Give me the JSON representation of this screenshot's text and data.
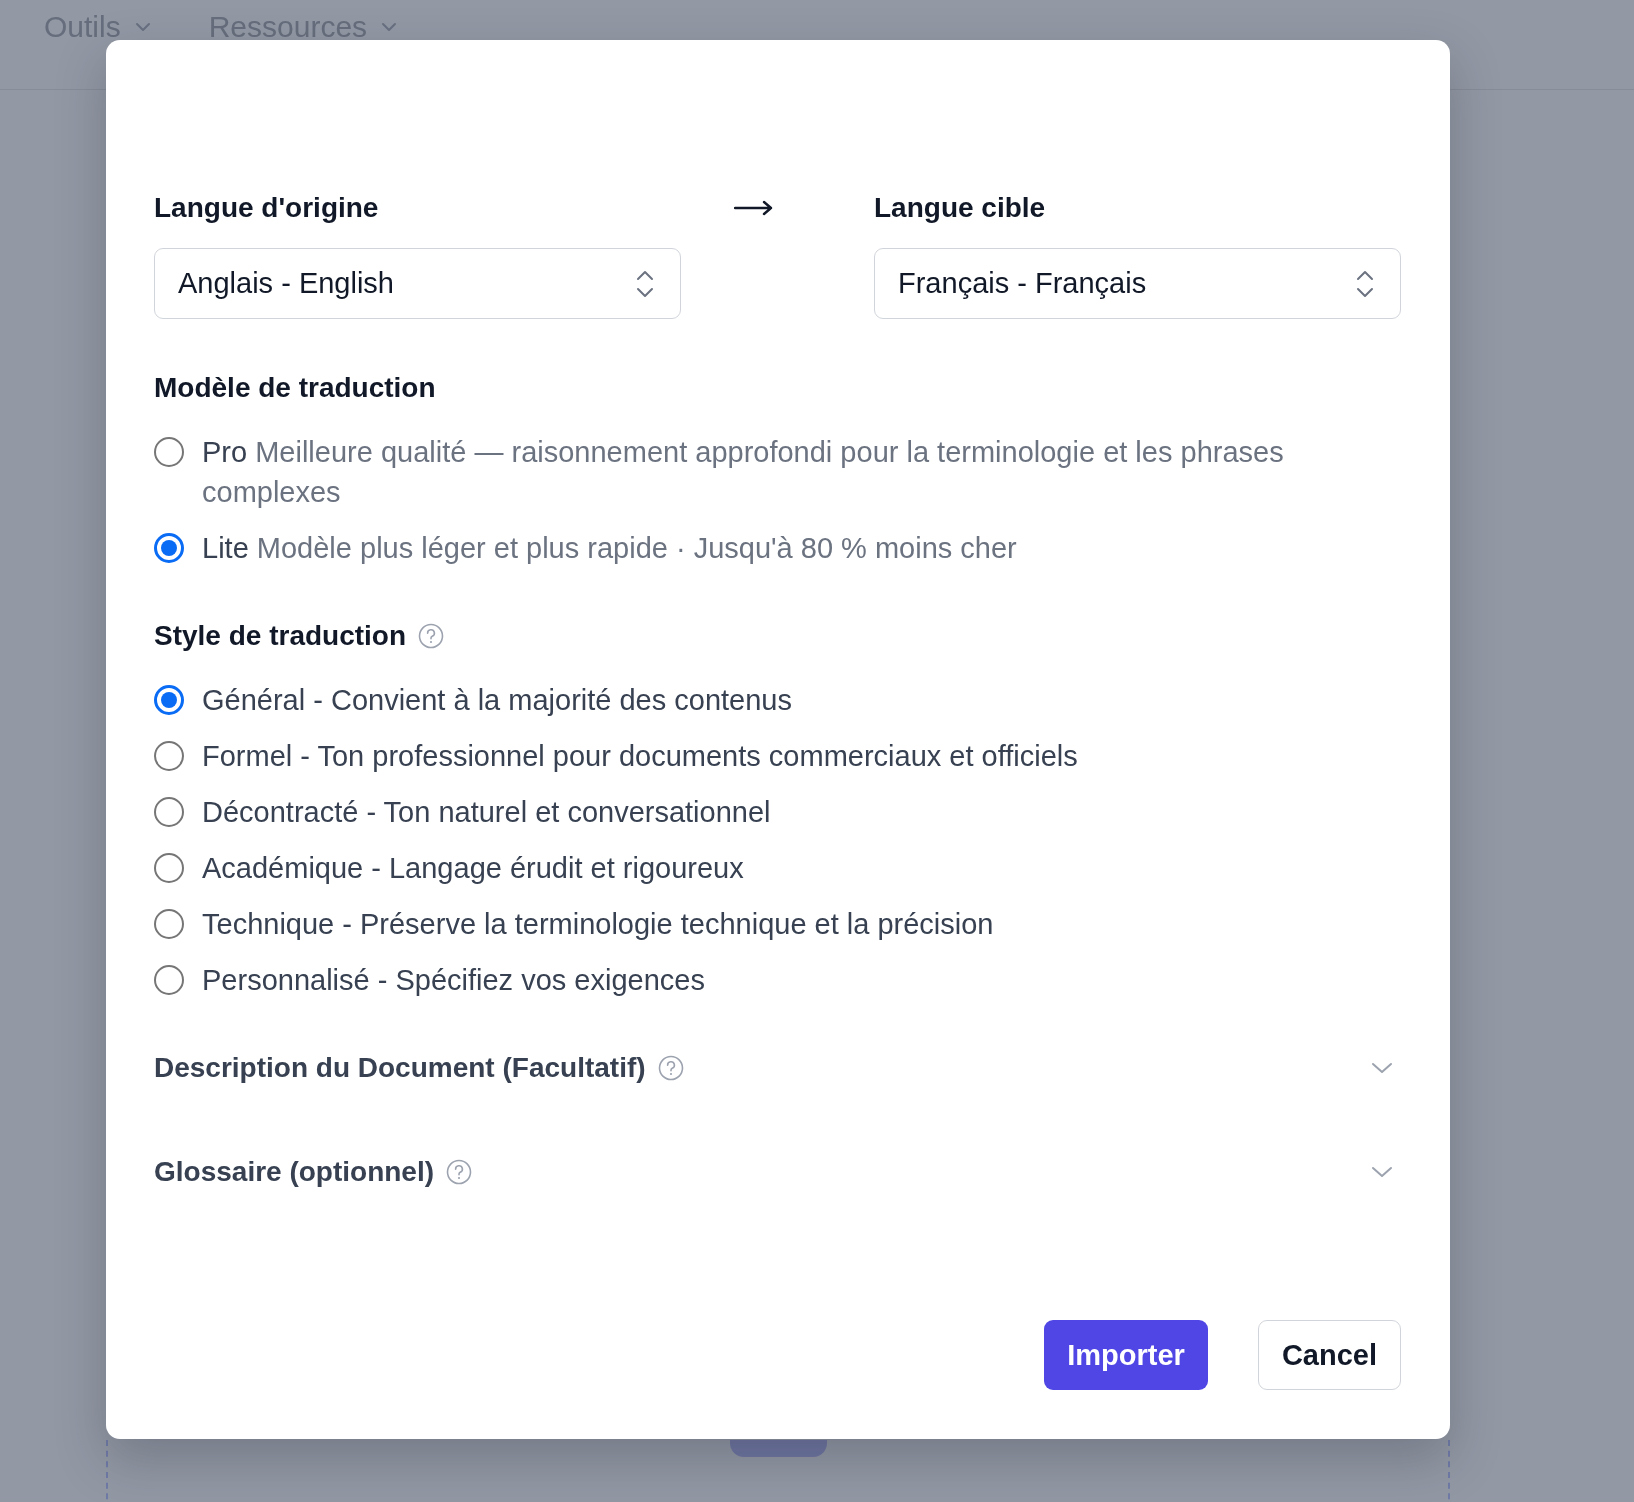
{
  "nav": [
    {
      "label": "Outils"
    },
    {
      "label": "Ressources"
    }
  ],
  "dialog": {
    "source": {
      "label": "Langue d'origine",
      "value": "Anglais - English"
    },
    "target": {
      "label": "Langue cible",
      "value": "Français - Français"
    },
    "model": {
      "title": "Modèle de traduction",
      "help": false,
      "options": [
        {
          "name": "Pro",
          "description": "Meilleure qualité — raisonnement approfondi pour la terminologie et les phrases complexes",
          "selected": false
        },
        {
          "name": "Lite",
          "description": "Modèle plus léger et plus rapide · Jusqu'à 80 % moins cher",
          "selected": true
        }
      ]
    },
    "style": {
      "title": "Style de traduction",
      "help": true,
      "options": [
        {
          "label": "Général - Convient à la majorité des contenus",
          "selected": true
        },
        {
          "label": "Formel - Ton professionnel pour documents commerciaux et officiels",
          "selected": false
        },
        {
          "label": "Décontracté - Ton naturel et conversationnel",
          "selected": false
        },
        {
          "label": "Académique - Langage érudit et rigoureux",
          "selected": false
        },
        {
          "label": "Technique - Préserve la terminologie technique et la précision",
          "selected": false
        },
        {
          "label": "Personnalisé - Spécifiez vos exigences",
          "selected": false
        }
      ]
    },
    "sections": [
      {
        "title": "Description du Document (Facultatif)",
        "help": true,
        "expanded": false
      },
      {
        "title": "Glossaire (optionnel)",
        "help": true,
        "expanded": false
      }
    ],
    "buttons": [
      {
        "label": "Importer",
        "kind": "primary"
      },
      {
        "label": "Cancel",
        "kind": "secondary"
      }
    ]
  }
}
